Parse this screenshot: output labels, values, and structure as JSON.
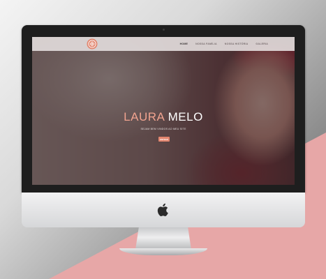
{
  "site": {
    "nav": {
      "items": [
        {
          "label": "HOME",
          "active": true
        },
        {
          "label": "NOSSA FAMÍLIA",
          "active": false
        },
        {
          "label": "NOSSA HISTÓRIA",
          "active": false
        },
        {
          "label": "GALERIA",
          "active": false
        }
      ]
    },
    "hero": {
      "title_first": "LAURA",
      "title_last": "MELO",
      "subtitle": "SEJAM BEM VINDOS AO MEU SITE",
      "button_label": "ENTRAR"
    }
  },
  "colors": {
    "accent": "#e2856e",
    "title_first": "#f0a38f",
    "nav_bar": "#e1dada",
    "background_pink": "#e7a7a7"
  },
  "icons": {
    "logo": "site-logo-icon",
    "apple": "apple-logo-icon"
  }
}
